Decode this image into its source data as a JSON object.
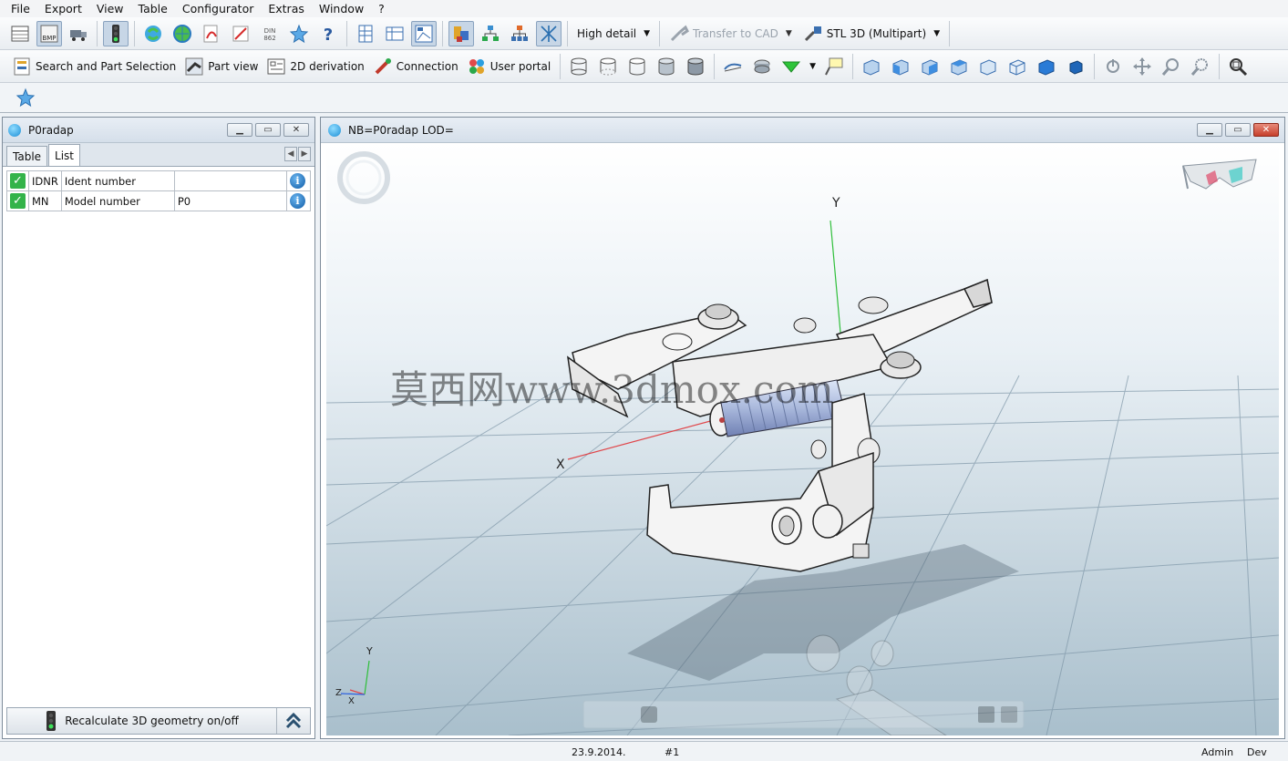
{
  "menu": [
    "File",
    "Export",
    "View",
    "Table",
    "Configurator",
    "Extras",
    "Window",
    "?"
  ],
  "toolbar1": {
    "detail_dropdown": "High detail",
    "transfer_label": "Transfer to CAD",
    "export_format": "STL 3D (Multipart)",
    "bmp_label": "BMP",
    "din_label": "DIN 862"
  },
  "toolbar2": {
    "search_label": "Search and Part Selection",
    "partview_label": "Part view",
    "derivation_label": "2D derivation",
    "connection_label": "Connection",
    "portal_label": "User portal"
  },
  "left_panel": {
    "title": "P0radap",
    "tabs": [
      "Table",
      "List"
    ],
    "rows": [
      {
        "code": "IDNR",
        "name": "Ident number",
        "value": ""
      },
      {
        "code": "MN",
        "name": "Model number",
        "value": "P0"
      }
    ],
    "recalc_label": "Recalculate 3D geometry on/off"
  },
  "viewport": {
    "title": "NB=P0radap LOD=",
    "axis_y": "Y",
    "axis_x": "X",
    "mini_y": "Y",
    "mini_x": "X",
    "mini_z": "Z",
    "watermark": "莫西网www.3dmox.com"
  },
  "status": {
    "date": "23.9.2014.",
    "number": "#1",
    "user": "Admin",
    "mode": "Dev"
  },
  "colors": {
    "accent": "#1c8ed6",
    "check_green": "#33b34a",
    "axis_x": "#e0464a",
    "axis_y": "#2fbf3a",
    "axis_z": "#2a5fe0"
  }
}
